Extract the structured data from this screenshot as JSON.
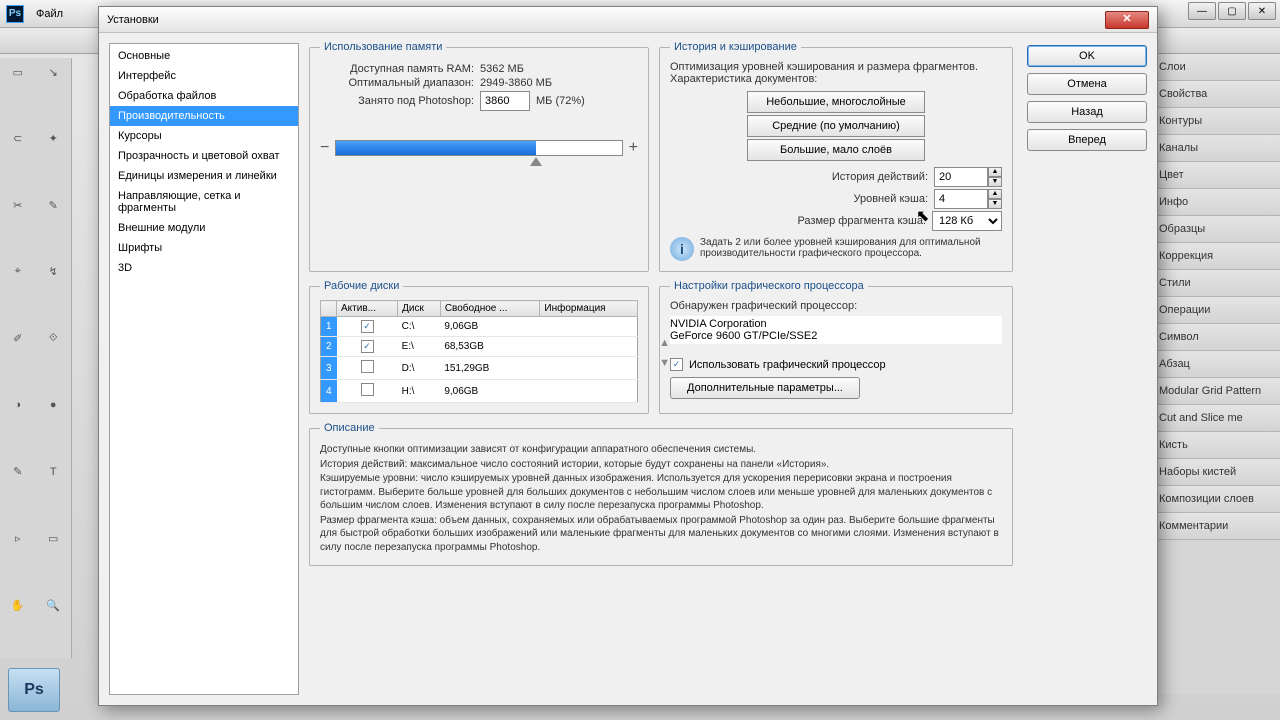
{
  "menubar": {
    "file": "Файл"
  },
  "dialog": {
    "title": "Установки",
    "categories": [
      "Основные",
      "Интерфейс",
      "Обработка файлов",
      "Производительность",
      "Курсоры",
      "Прозрачность и цветовой охват",
      "Единицы измерения и линейки",
      "Направляющие, сетка и фрагменты",
      "Внешние модули",
      "Шрифты",
      "3D"
    ],
    "buttons": {
      "ok": "OK",
      "cancel": "Отмена",
      "prev": "Назад",
      "next": "Вперед"
    },
    "memory": {
      "legend": "Использование памяти",
      "avail_lbl": "Доступная память RAM:",
      "avail_val": "5362 МБ",
      "range_lbl": "Оптимальный диапазон:",
      "range_val": "2949-3860 МБ",
      "used_lbl": "Занято под Photoshop:",
      "used_val": "3860",
      "used_suffix": "МБ (72%)",
      "minus": "−",
      "plus": "+"
    },
    "history": {
      "legend": "История и кэширование",
      "intro": "Оптимизация уровней кэширования и размера фрагментов. Характеристика документов:",
      "preset1": "Небольшие, многослойные",
      "preset2": "Средние (по умолчанию)",
      "preset3": "Большие, мало слоёв",
      "hist_lbl": "История действий:",
      "hist_val": "20",
      "cache_lbl": "Уровней кэша:",
      "cache_val": "4",
      "tile_lbl": "Размер фрагмента кэша:",
      "tile_val": "128 Кб",
      "tip": "Задать 2 или более уровней кэширования для оптимальной производительности графического процессора."
    },
    "scratch": {
      "legend": "Рабочие диски",
      "cols": {
        "active": "Актив...",
        "disk": "Диск",
        "free": "Свободное ...",
        "info": "Информация"
      },
      "rows": [
        {
          "n": "1",
          "active": true,
          "disk": "C:\\",
          "free": "9,06GB",
          "info": ""
        },
        {
          "n": "2",
          "active": true,
          "disk": "E:\\",
          "free": "68,53GB",
          "info": ""
        },
        {
          "n": "3",
          "active": false,
          "disk": "D:\\",
          "free": "151,29GB",
          "info": ""
        },
        {
          "n": "4",
          "active": false,
          "disk": "H:\\",
          "free": "9,06GB",
          "info": ""
        }
      ]
    },
    "gpu": {
      "legend": "Настройки графического процессора",
      "detected_lbl": "Обнаружен графический процессор:",
      "vendor": "NVIDIA Corporation",
      "device": "GeForce 9600 GT/PCIe/SSE2",
      "use_gpu": "Использовать графический процессор",
      "advanced": "Дополнительные параметры..."
    },
    "desc": {
      "legend": "Описание",
      "p1": "Доступные кнопки оптимизации зависят от конфигурации аппаратного обеспечения системы.",
      "p2": "История действий: максимальное число состояний истории, которые будут сохранены на панели «История».",
      "p3": "Кэшируемые уровни: число кэшируемых уровней данных изображения. Используется для ускорения перерисовки экрана и построения гистограмм. Выберите больше уровней для больших документов с небольшим числом слоев или меньше уровней для маленьких документов с большим числом слоев. Изменения вступают в силу после перезапуска программы Photoshop.",
      "p4": "Размер фрагмента кэша: объем данных, сохраняемых или обрабатываемых программой Photoshop за один раз. Выберите большие фрагменты для быстрой обработки больших изображений или маленькие фрагменты для маленьких документов со многими слоями. Изменения вступают в силу после перезапуска программы Photoshop."
    }
  },
  "panels": [
    "Слои",
    "Свойства",
    "Контуры",
    "Каналы",
    "Цвет",
    "Инфо",
    "Образцы",
    "Коррекция",
    "Стили",
    "Операции",
    "Символ",
    "Абзац",
    "Modular Grid Pattern",
    "Cut and Slice me",
    "Кисть",
    "Наборы кистей",
    "Композиции слоев",
    "Комментарии"
  ]
}
